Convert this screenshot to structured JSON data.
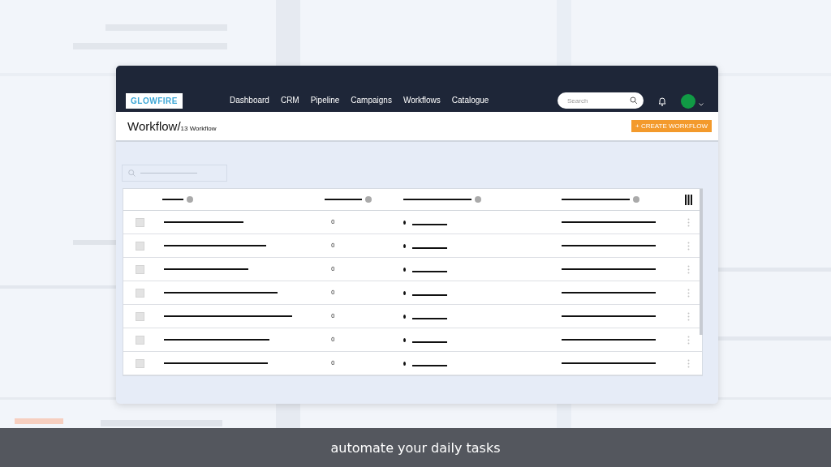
{
  "app": {
    "logo": "GLOWFIRE",
    "nav": [
      {
        "label": "Dashboard"
      },
      {
        "label": "CRM"
      },
      {
        "label": "Pipeline"
      },
      {
        "label": "Campaigns"
      },
      {
        "label": "Workflows"
      },
      {
        "label": "Catalogue"
      }
    ],
    "search": {
      "placeholder": "Search"
    }
  },
  "page": {
    "title": "Workflow/",
    "subtitle": "13 Workflow",
    "create_button": "+ CREATE WORKFLOW"
  },
  "table": {
    "rows": [
      {
        "checked": false,
        "count": "0"
      },
      {
        "checked": false,
        "count": "0"
      },
      {
        "checked": false,
        "count": "0"
      },
      {
        "checked": false,
        "count": "0"
      },
      {
        "checked": false,
        "count": "0"
      },
      {
        "checked": false,
        "count": "0"
      },
      {
        "checked": false,
        "count": "0"
      }
    ]
  },
  "caption": "automate your daily tasks"
}
